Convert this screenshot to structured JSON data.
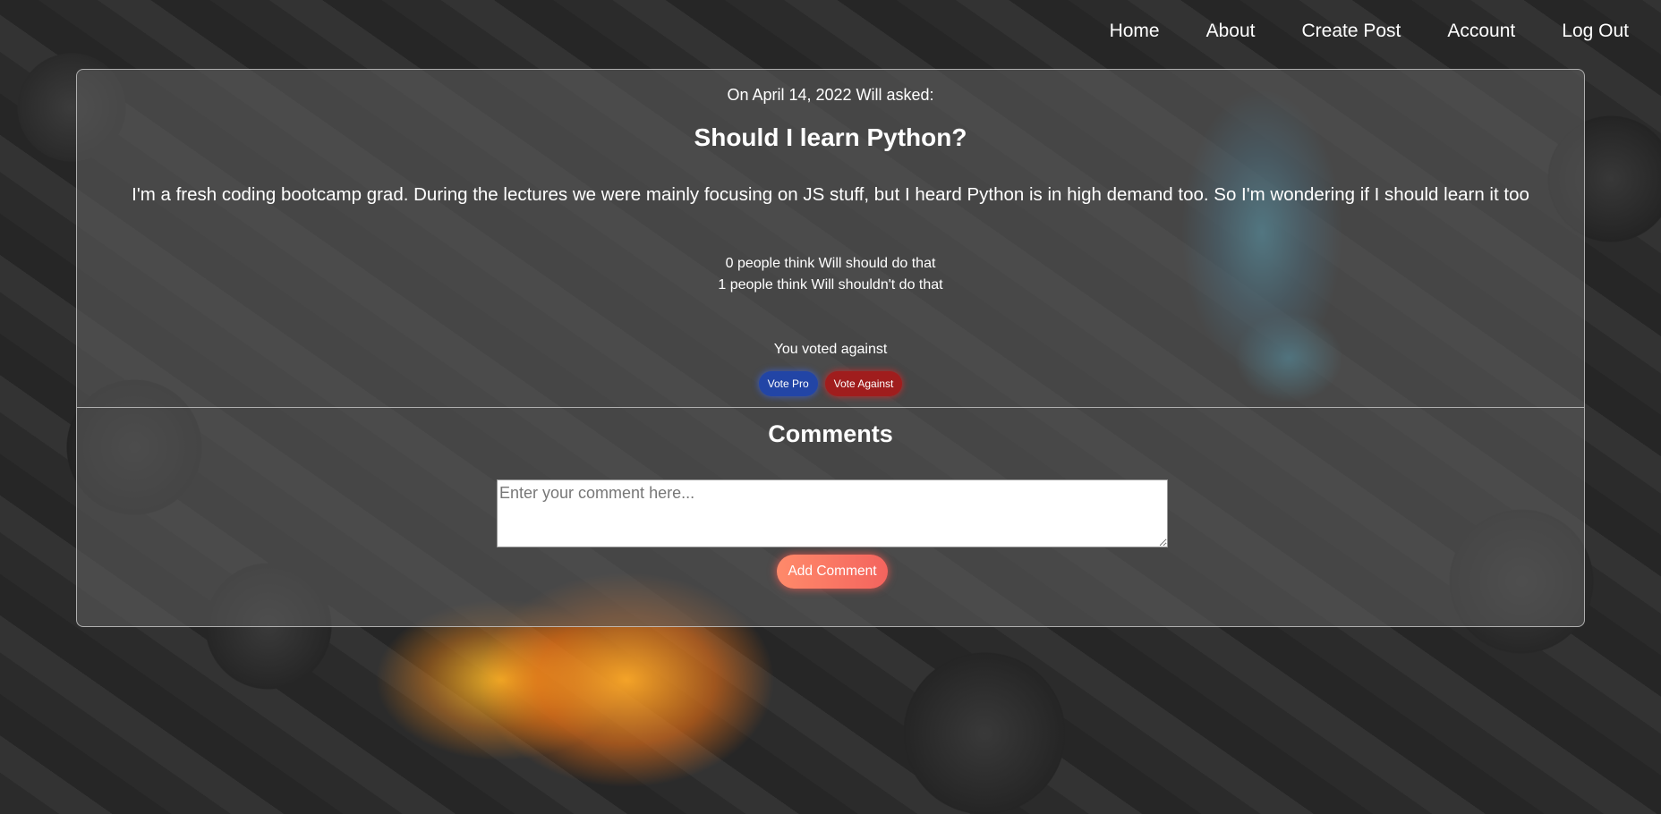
{
  "nav": {
    "items": [
      {
        "label": "Home"
      },
      {
        "label": "About"
      },
      {
        "label": "Create Post"
      },
      {
        "label": "Account"
      },
      {
        "label": "Log Out"
      }
    ]
  },
  "post": {
    "meta": "On April 14, 2022 Will asked:",
    "title": "Should I learn Python?",
    "body": "I'm a fresh coding bootcamp grad. During the lectures we were mainly focusing on JS stuff, but I heard Python is in high demand too. So I'm wondering if I should learn it too",
    "pro_count_text": "0 people think Will should do that",
    "against_count_text": "1 people think Will shouldn't do that",
    "vote_status": "You voted against",
    "vote_pro_label": "Vote Pro",
    "vote_against_label": "Vote Against"
  },
  "comments": {
    "heading": "Comments",
    "input_placeholder": "Enter your comment here...",
    "input_value": "",
    "add_label": "Add Comment"
  },
  "colors": {
    "vote_pro": "#2245a6",
    "vote_against": "#a01d1d",
    "add_comment": "#f4645e"
  }
}
